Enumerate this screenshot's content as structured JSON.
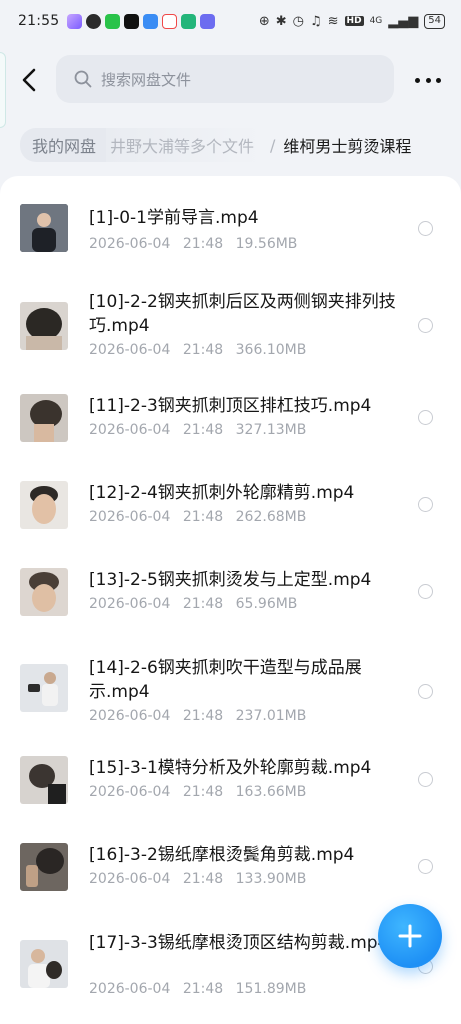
{
  "status_bar": {
    "time": "21:55",
    "network": "4G",
    "hd": "HD",
    "battery": "54"
  },
  "search": {
    "placeholder": "搜索网盘文件"
  },
  "breadcrumb": {
    "root": "我的网盘",
    "middle": "井野大浦等多个文件",
    "separator": "/",
    "current": "维柯男士剪烫课程"
  },
  "files": [
    {
      "name": "[1]-0-1学前导言.mp4",
      "date": "2026-06-04",
      "time": "21:48",
      "size": "19.56MB",
      "thumb_color": "#3a3f48"
    },
    {
      "name": "[10]-2-2钢夹抓刺后区及两侧钢夹排列技巧.mp4",
      "date": "2026-06-04",
      "time": "21:48",
      "size": "366.10MB",
      "thumb_color": "#5b5752"
    },
    {
      "name": "[11]-2-3钢夹抓刺顶区排杠技巧.mp4",
      "date": "2026-06-04",
      "time": "21:48",
      "size": "327.13MB",
      "thumb_color": "#6b6460"
    },
    {
      "name": "[12]-2-4钢夹抓刺外轮廓精剪.mp4",
      "date": "2026-06-04",
      "time": "21:48",
      "size": "262.68MB",
      "thumb_color": "#8f7c70"
    },
    {
      "name": "[13]-2-5钢夹抓刺烫发与上定型.mp4",
      "date": "2026-06-04",
      "time": "21:48",
      "size": "65.96MB",
      "thumb_color": "#9a8576"
    },
    {
      "name": "[14]-2-6钢夹抓刺吹干造型与成品展示.mp4",
      "date": "2026-06-04",
      "time": "21:48",
      "size": "237.01MB",
      "thumb_color": "#c9cdd2"
    },
    {
      "name": "[15]-3-1模特分析及外轮廓剪裁.mp4",
      "date": "2026-06-04",
      "time": "21:48",
      "size": "163.66MB",
      "thumb_color": "#7d7670"
    },
    {
      "name": "[16]-3-2锡纸摩根烫鬓角剪裁.mp4",
      "date": "2026-06-04",
      "time": "21:48",
      "size": "133.90MB",
      "thumb_color": "#4a4643"
    },
    {
      "name": "[17]-3-3锡纸摩根烫顶区结构剪裁.mp4",
      "date": "2026-06-04",
      "time": "21:48",
      "size": "151.89MB",
      "thumb_color": "#d2d4d8"
    }
  ],
  "icons": {
    "back": "back-arrow-icon",
    "search": "search-icon",
    "more": "more-icon",
    "fab": "plus-icon"
  },
  "colors": {
    "accent": "#1e90f5",
    "background": "#f1f3f7"
  }
}
